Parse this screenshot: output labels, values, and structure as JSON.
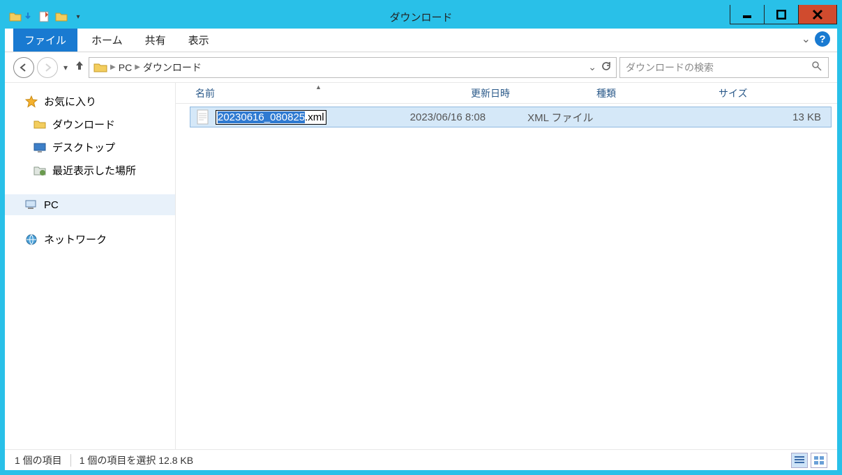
{
  "window": {
    "title": "ダウンロード"
  },
  "ribbon": {
    "file": "ファイル",
    "home": "ホーム",
    "share": "共有",
    "view": "表示"
  },
  "nav": {
    "pc": "PC",
    "downloads": "ダウンロード"
  },
  "search": {
    "placeholder": "ダウンロードの検索"
  },
  "sidebar": {
    "favorites": "お気に入り",
    "downloads": "ダウンロード",
    "desktop": "デスクトップ",
    "recent": "最近表示した場所",
    "pc": "PC",
    "network": "ネットワーク"
  },
  "columns": {
    "name": "名前",
    "date": "更新日時",
    "type": "種類",
    "size": "サイズ"
  },
  "file": {
    "name_selected": "20230616_080825",
    "name_rest": ".xml",
    "date": "2023/06/16 8:08",
    "type": "XML ファイル",
    "size": "13 KB"
  },
  "status": {
    "count": "1 個の項目",
    "selection": "1 個の項目を選択 12.8 KB"
  }
}
